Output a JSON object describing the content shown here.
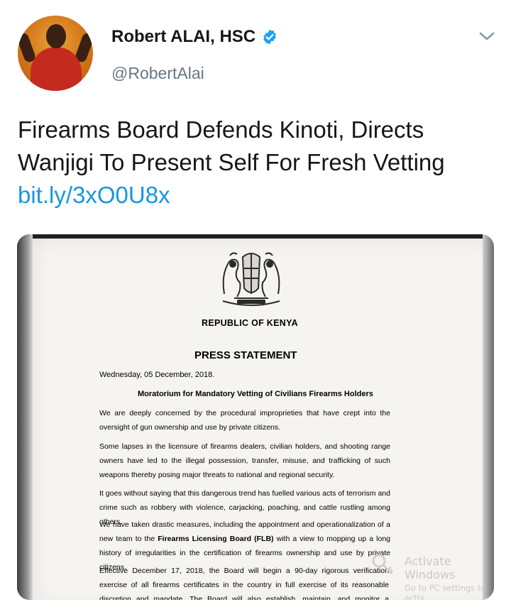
{
  "author": {
    "name": "Robert ALAI, HSC",
    "handle": "@RobertAlai",
    "verified_icon": "verified-badge-icon",
    "menu_icon": "chevron-down-icon"
  },
  "tweet": {
    "line1": "Firearms Board Defends Kinoti, Directs",
    "line2": "Wanjigi To Present Self For Fresh Vetting",
    "link": "bit.ly/3xO0U8x"
  },
  "document": {
    "republic": "REPUBLIC OF KENYA",
    "title": "PRESS STATEMENT",
    "date": "Wednesday, 05 December, 2018.",
    "subject": "Moratorium for Mandatory Vetting of Civilians Firearms Holders",
    "p1": "We are deeply concerned by the procedural improprieties that have crept into the oversight of gun ownership and use by private citizens.",
    "p2": "Some lapses in the licensure of firearms dealers, civilian holders, and shooting range owners have led to the illegal possession, transfer, misuse, and trafficking of such weapons thereby posing major threats to national and regional security.",
    "p3": "It goes without saying that this dangerous trend has fuelled various acts of terrorism and crime such as robbery with violence, carjacking, poaching, and cattle rustling among others.",
    "p4_a": "We have taken drastic measures, including the appointment and operationalization of a new team to the ",
    "p4_b": "Firearms Licensing Board (FLB)",
    "p4_c": " with a view to mopping up a long history of irregularities in the certification of firearms ownership and use by private citizens.",
    "p5": "Effective December 17, 2018, the Board will begin a 90-day rigorous verification exercise of all firearms certificates in the country in full exercise of its reasonable discretion and mandate. The Board will also establish, maintain, and monitor a centralized Electronic"
  },
  "watermark": {
    "title": "Activate Windows",
    "subtitle": "Go to PC settings to activ"
  },
  "colors": {
    "link": "#1b95e0",
    "verified": "#1da1f2",
    "text": "#14171a",
    "muted": "#657786"
  }
}
